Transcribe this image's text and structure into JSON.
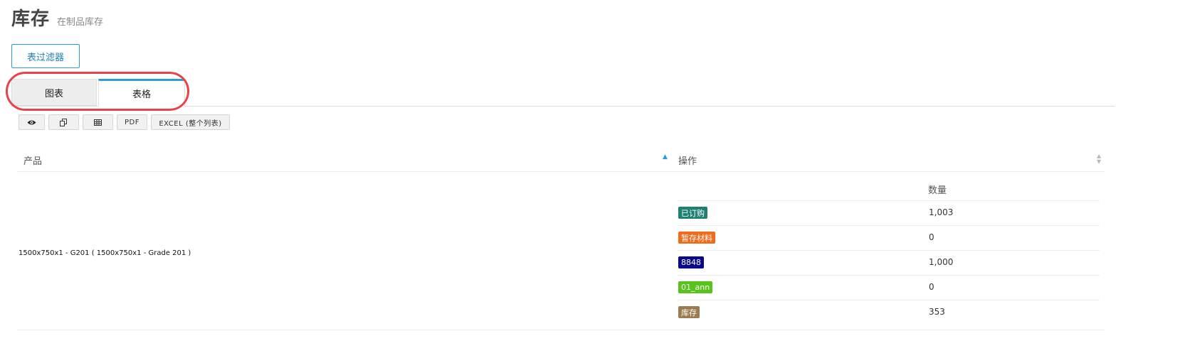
{
  "header": {
    "title": "库存",
    "subtitle": "在制品库存"
  },
  "filter_button": {
    "label": "表过滤器"
  },
  "tabs": [
    {
      "label": "图表",
      "active": false
    },
    {
      "label": "表格",
      "active": true
    }
  ],
  "toolbar": {
    "view_icon": "eye-icon",
    "copy_icon": "copy-icon",
    "columns_icon": "table-columns-icon",
    "pdf_label": "PDF",
    "excel_label": "EXCEL (整个列表)"
  },
  "table": {
    "columns": {
      "product": "产品",
      "operations": "操作"
    },
    "sub_header": "数量",
    "product": "1500x750x1 - G201 ( 1500x750x1 - Grade 201 )",
    "rows": [
      {
        "status": "已订购",
        "color": "#1e7f72",
        "qty": "1,003"
      },
      {
        "status": "暂存材料",
        "color": "#f26b1d",
        "qty": "0"
      },
      {
        "status": "8848",
        "color": "#07078f",
        "qty": "1,000"
      },
      {
        "status": "01_ann",
        "color": "#57c31b",
        "qty": "0"
      },
      {
        "status": "库存",
        "color": "#9a7b52",
        "qty": "353"
      }
    ]
  },
  "colors": {
    "accent": "#2a9fd6",
    "highlight": "#e8424a"
  }
}
